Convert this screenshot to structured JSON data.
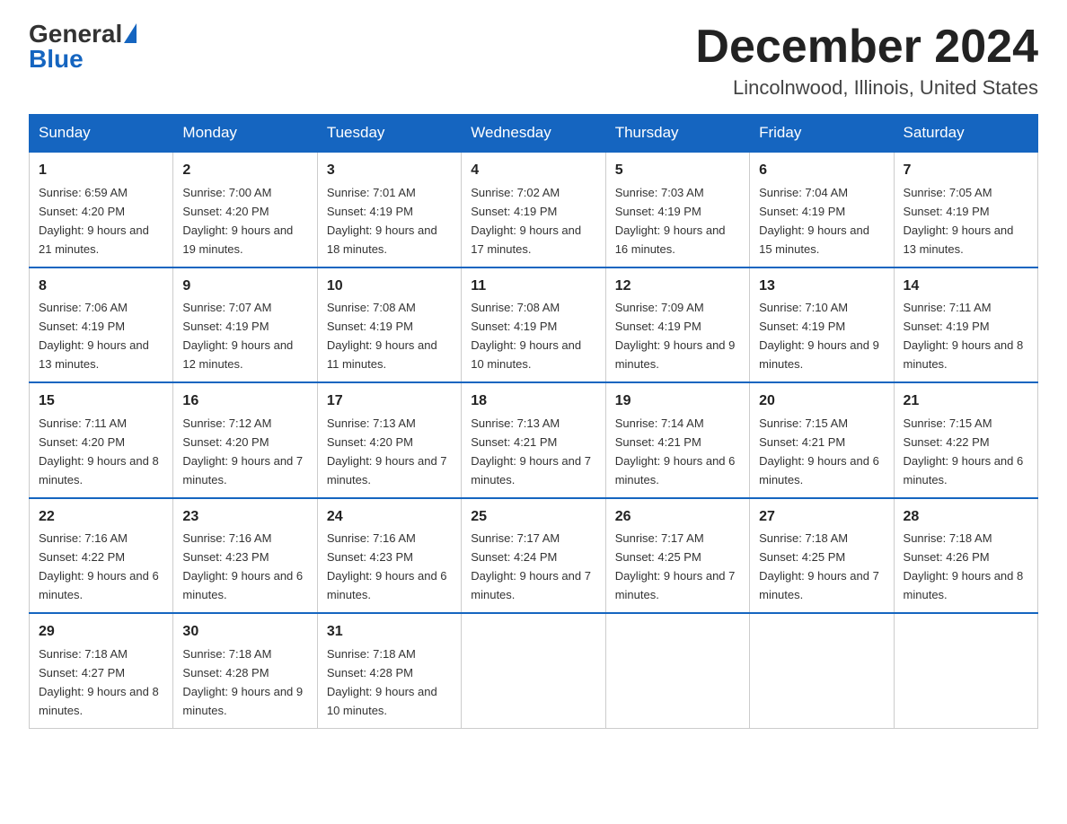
{
  "header": {
    "logo_general": "General",
    "logo_blue": "Blue",
    "month_title": "December 2024",
    "location": "Lincolnwood, Illinois, United States"
  },
  "days_of_week": [
    "Sunday",
    "Monday",
    "Tuesday",
    "Wednesday",
    "Thursday",
    "Friday",
    "Saturday"
  ],
  "weeks": [
    [
      {
        "day": "1",
        "sunrise": "6:59 AM",
        "sunset": "4:20 PM",
        "daylight": "9 hours and 21 minutes."
      },
      {
        "day": "2",
        "sunrise": "7:00 AM",
        "sunset": "4:20 PM",
        "daylight": "9 hours and 19 minutes."
      },
      {
        "day": "3",
        "sunrise": "7:01 AM",
        "sunset": "4:19 PM",
        "daylight": "9 hours and 18 minutes."
      },
      {
        "day": "4",
        "sunrise": "7:02 AM",
        "sunset": "4:19 PM",
        "daylight": "9 hours and 17 minutes."
      },
      {
        "day": "5",
        "sunrise": "7:03 AM",
        "sunset": "4:19 PM",
        "daylight": "9 hours and 16 minutes."
      },
      {
        "day": "6",
        "sunrise": "7:04 AM",
        "sunset": "4:19 PM",
        "daylight": "9 hours and 15 minutes."
      },
      {
        "day": "7",
        "sunrise": "7:05 AM",
        "sunset": "4:19 PM",
        "daylight": "9 hours and 13 minutes."
      }
    ],
    [
      {
        "day": "8",
        "sunrise": "7:06 AM",
        "sunset": "4:19 PM",
        "daylight": "9 hours and 13 minutes."
      },
      {
        "day": "9",
        "sunrise": "7:07 AM",
        "sunset": "4:19 PM",
        "daylight": "9 hours and 12 minutes."
      },
      {
        "day": "10",
        "sunrise": "7:08 AM",
        "sunset": "4:19 PM",
        "daylight": "9 hours and 11 minutes."
      },
      {
        "day": "11",
        "sunrise": "7:08 AM",
        "sunset": "4:19 PM",
        "daylight": "9 hours and 10 minutes."
      },
      {
        "day": "12",
        "sunrise": "7:09 AM",
        "sunset": "4:19 PM",
        "daylight": "9 hours and 9 minutes."
      },
      {
        "day": "13",
        "sunrise": "7:10 AM",
        "sunset": "4:19 PM",
        "daylight": "9 hours and 9 minutes."
      },
      {
        "day": "14",
        "sunrise": "7:11 AM",
        "sunset": "4:19 PM",
        "daylight": "9 hours and 8 minutes."
      }
    ],
    [
      {
        "day": "15",
        "sunrise": "7:11 AM",
        "sunset": "4:20 PM",
        "daylight": "9 hours and 8 minutes."
      },
      {
        "day": "16",
        "sunrise": "7:12 AM",
        "sunset": "4:20 PM",
        "daylight": "9 hours and 7 minutes."
      },
      {
        "day": "17",
        "sunrise": "7:13 AM",
        "sunset": "4:20 PM",
        "daylight": "9 hours and 7 minutes."
      },
      {
        "day": "18",
        "sunrise": "7:13 AM",
        "sunset": "4:21 PM",
        "daylight": "9 hours and 7 minutes."
      },
      {
        "day": "19",
        "sunrise": "7:14 AM",
        "sunset": "4:21 PM",
        "daylight": "9 hours and 6 minutes."
      },
      {
        "day": "20",
        "sunrise": "7:15 AM",
        "sunset": "4:21 PM",
        "daylight": "9 hours and 6 minutes."
      },
      {
        "day": "21",
        "sunrise": "7:15 AM",
        "sunset": "4:22 PM",
        "daylight": "9 hours and 6 minutes."
      }
    ],
    [
      {
        "day": "22",
        "sunrise": "7:16 AM",
        "sunset": "4:22 PM",
        "daylight": "9 hours and 6 minutes."
      },
      {
        "day": "23",
        "sunrise": "7:16 AM",
        "sunset": "4:23 PM",
        "daylight": "9 hours and 6 minutes."
      },
      {
        "day": "24",
        "sunrise": "7:16 AM",
        "sunset": "4:23 PM",
        "daylight": "9 hours and 6 minutes."
      },
      {
        "day": "25",
        "sunrise": "7:17 AM",
        "sunset": "4:24 PM",
        "daylight": "9 hours and 7 minutes."
      },
      {
        "day": "26",
        "sunrise": "7:17 AM",
        "sunset": "4:25 PM",
        "daylight": "9 hours and 7 minutes."
      },
      {
        "day": "27",
        "sunrise": "7:18 AM",
        "sunset": "4:25 PM",
        "daylight": "9 hours and 7 minutes."
      },
      {
        "day": "28",
        "sunrise": "7:18 AM",
        "sunset": "4:26 PM",
        "daylight": "9 hours and 8 minutes."
      }
    ],
    [
      {
        "day": "29",
        "sunrise": "7:18 AM",
        "sunset": "4:27 PM",
        "daylight": "9 hours and 8 minutes."
      },
      {
        "day": "30",
        "sunrise": "7:18 AM",
        "sunset": "4:28 PM",
        "daylight": "9 hours and 9 minutes."
      },
      {
        "day": "31",
        "sunrise": "7:18 AM",
        "sunset": "4:28 PM",
        "daylight": "9 hours and 10 minutes."
      },
      null,
      null,
      null,
      null
    ]
  ]
}
